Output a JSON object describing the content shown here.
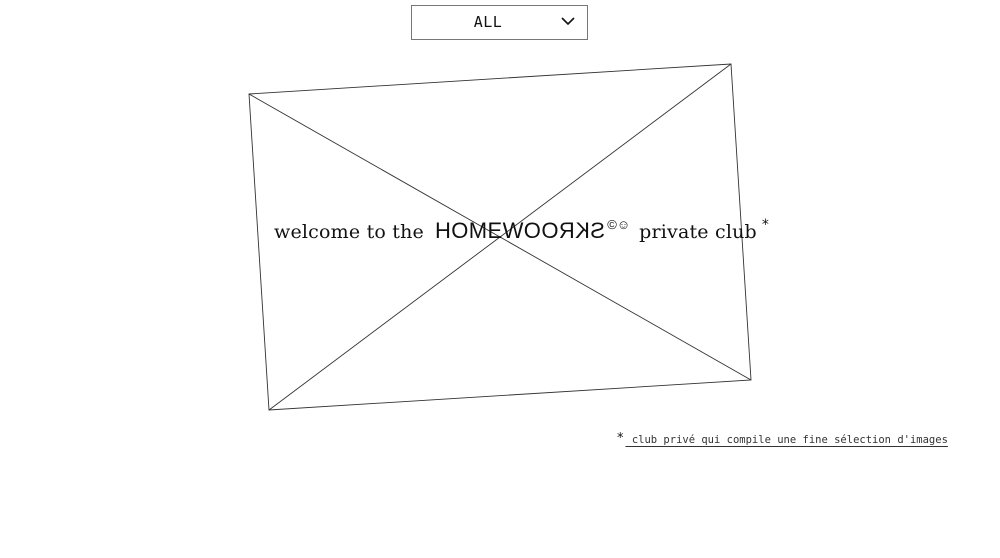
{
  "filter": {
    "selected": "ALL",
    "icon": "chevron-down-icon"
  },
  "welcome": {
    "prefix": "welcome to the",
    "brand_normal": "HOMEWO",
    "brand_mirrored": "HOMEWO",
    "brand_mirrored_reversed_text": "SKRO",
    "brand_symbols": "©☺",
    "suffix": "private club",
    "asterisk": "*"
  },
  "placeholder": {
    "icon": "image-placeholder-icon"
  },
  "footnote": {
    "mark": "*",
    "text": " club privé qui compile une fine sélection d'images "
  }
}
